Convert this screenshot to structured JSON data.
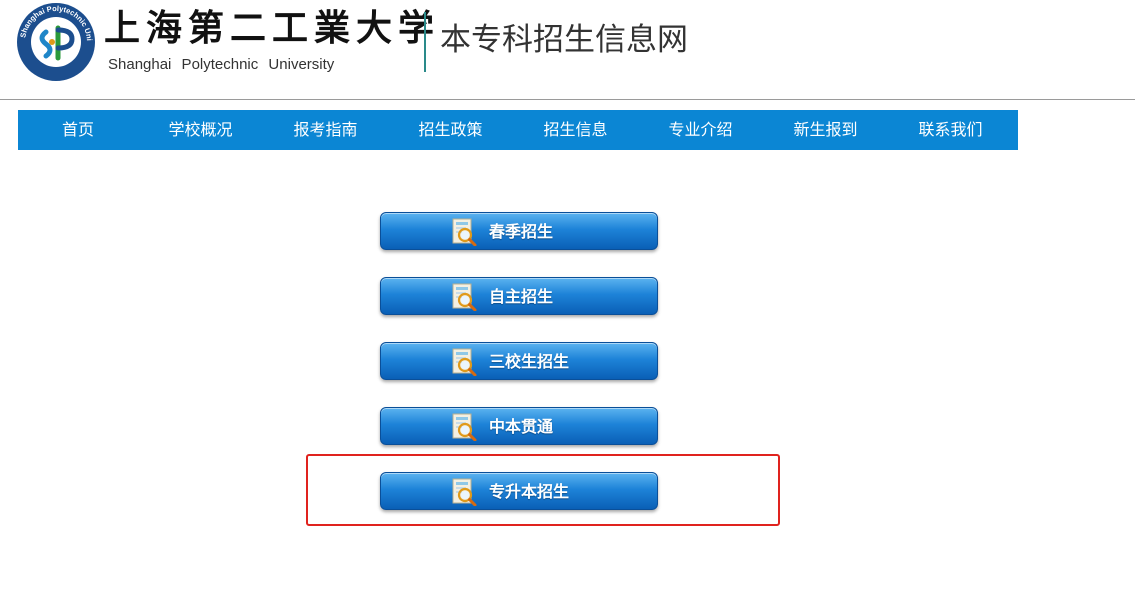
{
  "header": {
    "logo_cn": "上海第二工業大学",
    "logo_en": "Shanghai Polytechnic University",
    "seal_text": "Shanghai Polytechnic University",
    "site_title": "本专科招生信息网"
  },
  "nav": {
    "items": [
      {
        "label": "首页"
      },
      {
        "label": "学校概况"
      },
      {
        "label": "报考指南"
      },
      {
        "label": "招生政策"
      },
      {
        "label": "招生信息"
      },
      {
        "label": "专业介绍"
      },
      {
        "label": "新生报到"
      },
      {
        "label": "联系我们"
      }
    ]
  },
  "buttons": [
    {
      "label": "春季招生",
      "icon": "search-document-icon"
    },
    {
      "label": "自主招生",
      "icon": "search-document-icon"
    },
    {
      "label": "三校生招生",
      "icon": "search-document-icon"
    },
    {
      "label": "中本贯通",
      "icon": "search-document-icon"
    },
    {
      "label": "专升本招生",
      "icon": "search-document-icon"
    }
  ],
  "colors": {
    "nav_bg": "#0b86d4",
    "button_top": "#5cb3f0",
    "button_bottom": "#0a5fb6",
    "highlight_border": "#e0231e"
  }
}
